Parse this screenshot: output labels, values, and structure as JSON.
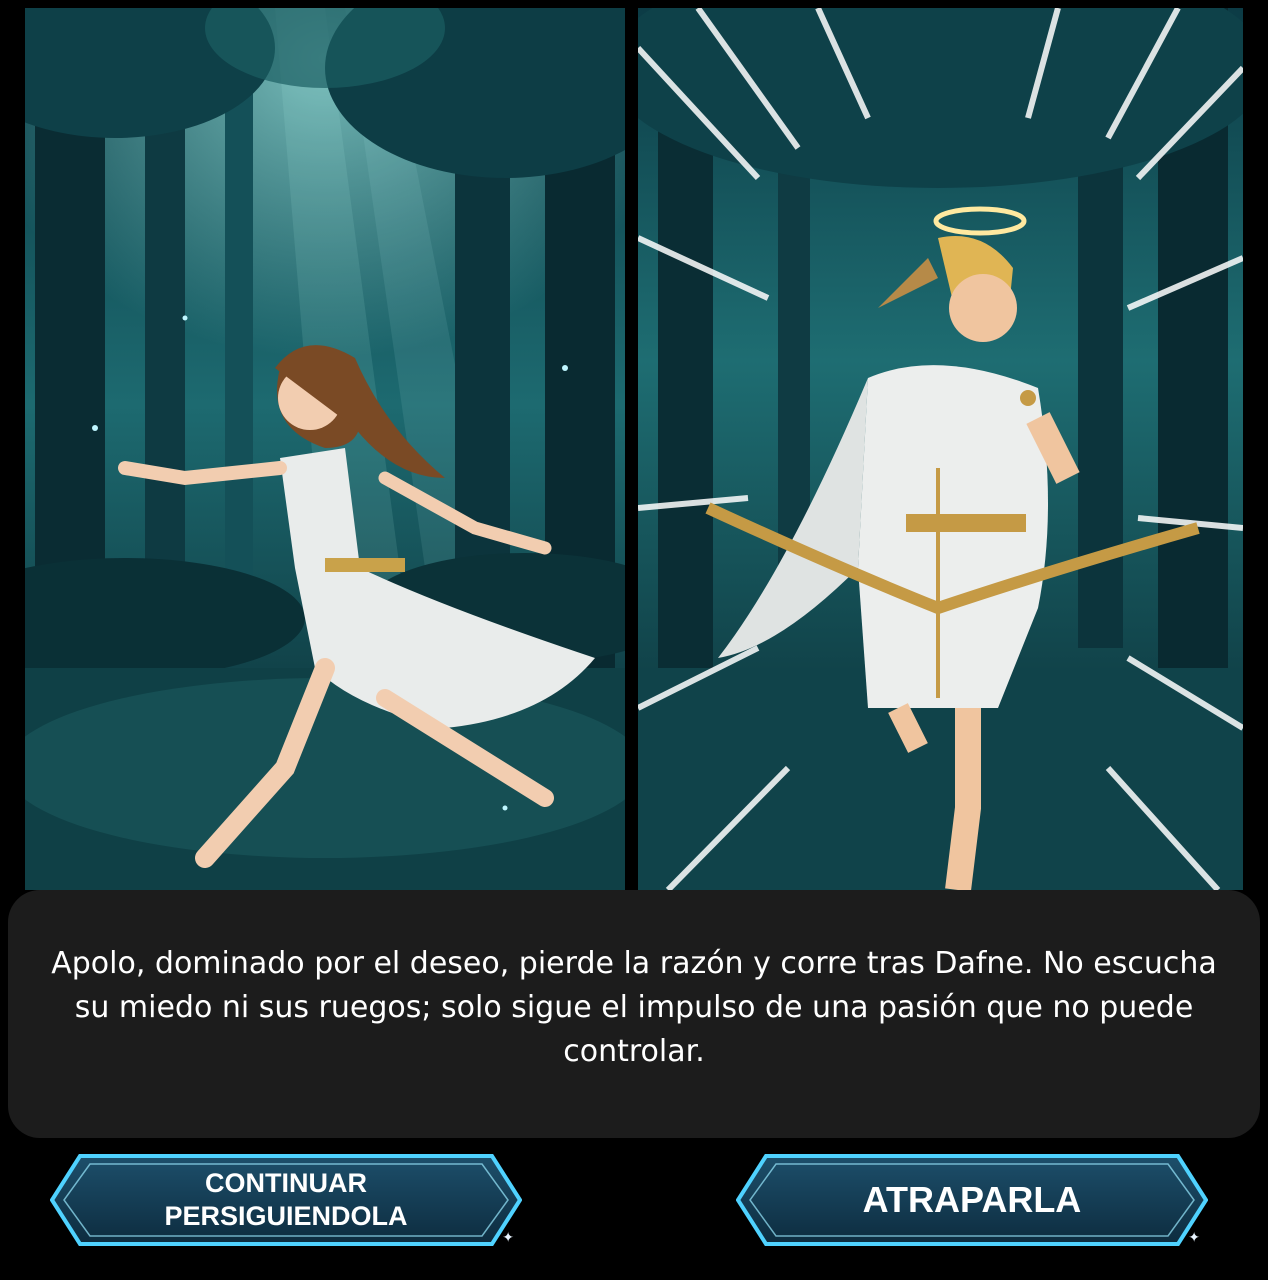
{
  "scene": {
    "left_panel": {
      "alt": "Dafne huyendo por el bosque"
    },
    "right_panel": {
      "alt": "Apolo persiguiendo a Dafne"
    }
  },
  "dialog": {
    "text": "Apolo, dominado por el deseo, pierde la razón y corre tras Dafne. No escucha su miedo ni sus ruegos; solo sigue el impulso de una pasión que no puede controlar."
  },
  "choices": [
    {
      "label": "CONTINUAR PERSIGUIENDOLA"
    },
    {
      "label": "ATRAPARLA"
    }
  ],
  "icons": {
    "sparkle": "sparkle-icon"
  },
  "colors": {
    "background": "#000000",
    "dialog_bg": "#1c1c1c",
    "button_glow": "#4fd2ff",
    "button_fill": "#133a52",
    "forest_dark": "#06212a",
    "forest_light": "#2f8a8c"
  }
}
